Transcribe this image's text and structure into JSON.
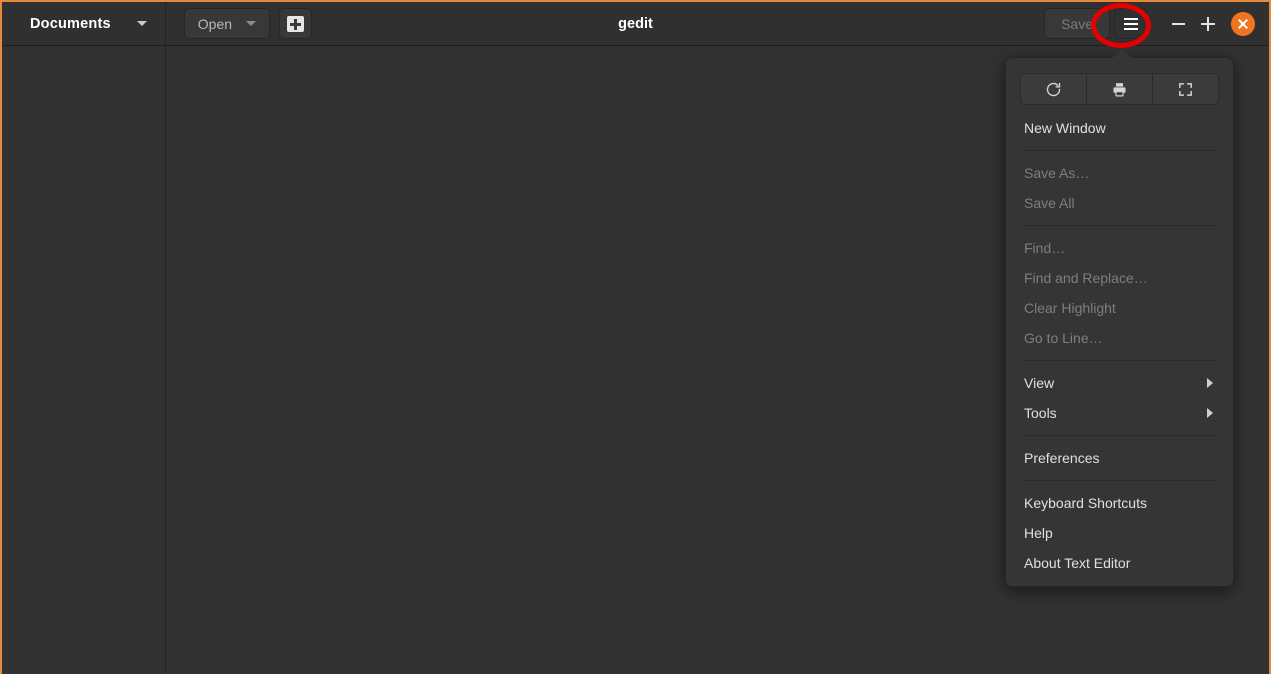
{
  "window": {
    "title": "gedit",
    "accent_border_color": "#e8883a",
    "background_color": "#303030"
  },
  "headerbar": {
    "documents_button": {
      "label": "Documents",
      "icon": "chevron-down-icon"
    },
    "open_button": {
      "label": "Open",
      "icon": "chevron-down-icon"
    },
    "new_document_button": {
      "icon": "new-document-icon"
    },
    "save_button": {
      "label": "Save",
      "enabled": false
    },
    "menu_button": {
      "icon": "hamburger-menu-icon",
      "highlighted": true
    },
    "minimize_button": {
      "label": "–",
      "icon": "minimize-icon"
    },
    "maximize_button": {
      "label": "+",
      "icon": "maximize-icon"
    },
    "close_button": {
      "label": "×",
      "icon": "close-icon",
      "color": "#f07520"
    }
  },
  "menu_popover": {
    "icon_buttons": [
      {
        "name": "reload-icon",
        "label": "Reload"
      },
      {
        "name": "print-icon",
        "label": "Print"
      },
      {
        "name": "fullscreen-icon",
        "label": "Fullscreen"
      }
    ],
    "groups": [
      {
        "items": [
          {
            "label": "New Window",
            "enabled": true,
            "submenu": false
          }
        ]
      },
      {
        "items": [
          {
            "label": "Save As…",
            "enabled": false,
            "submenu": false
          },
          {
            "label": "Save All",
            "enabled": false,
            "submenu": false
          }
        ]
      },
      {
        "items": [
          {
            "label": "Find…",
            "enabled": false,
            "submenu": false
          },
          {
            "label": "Find and Replace…",
            "enabled": false,
            "submenu": false
          },
          {
            "label": "Clear Highlight",
            "enabled": false,
            "submenu": false
          },
          {
            "label": "Go to Line…",
            "enabled": false,
            "submenu": false
          }
        ]
      },
      {
        "items": [
          {
            "label": "View",
            "enabled": true,
            "submenu": true
          },
          {
            "label": "Tools",
            "enabled": true,
            "submenu": true
          }
        ]
      },
      {
        "items": [
          {
            "label": "Preferences",
            "enabled": true,
            "submenu": false
          }
        ]
      },
      {
        "items": [
          {
            "label": "Keyboard Shortcuts",
            "enabled": true,
            "submenu": false
          },
          {
            "label": "Help",
            "enabled": true,
            "submenu": false
          },
          {
            "label": "About Text Editor",
            "enabled": true,
            "submenu": false
          }
        ]
      }
    ]
  },
  "side_panel": {
    "items": []
  },
  "editor": {
    "content": ""
  },
  "annotation": {
    "type": "ellipse-highlight",
    "color": "#e60000",
    "target": "menu-button"
  }
}
